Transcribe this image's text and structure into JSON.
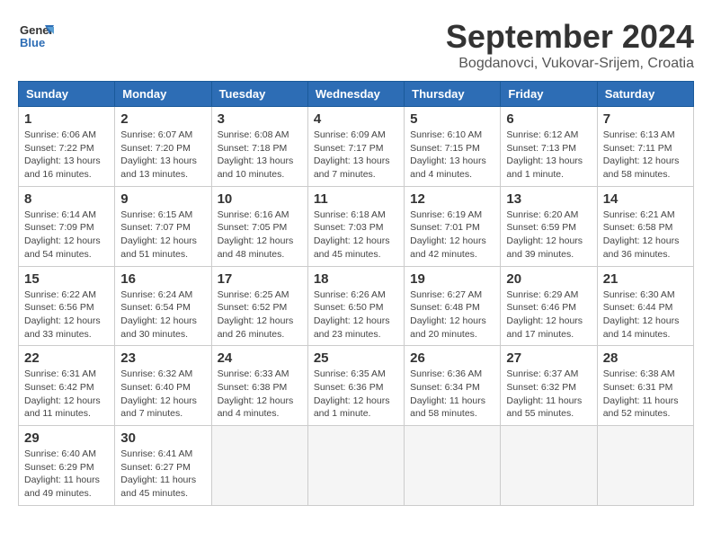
{
  "header": {
    "logo_line1": "General",
    "logo_line2": "Blue",
    "month_year": "September 2024",
    "location": "Bogdanovci, Vukovar-Srijem, Croatia"
  },
  "weekdays": [
    "Sunday",
    "Monday",
    "Tuesday",
    "Wednesday",
    "Thursday",
    "Friday",
    "Saturday"
  ],
  "weeks": [
    [
      {
        "day": "1",
        "info": "Sunrise: 6:06 AM\nSunset: 7:22 PM\nDaylight: 13 hours\nand 16 minutes."
      },
      {
        "day": "2",
        "info": "Sunrise: 6:07 AM\nSunset: 7:20 PM\nDaylight: 13 hours\nand 13 minutes."
      },
      {
        "day": "3",
        "info": "Sunrise: 6:08 AM\nSunset: 7:18 PM\nDaylight: 13 hours\nand 10 minutes."
      },
      {
        "day": "4",
        "info": "Sunrise: 6:09 AM\nSunset: 7:17 PM\nDaylight: 13 hours\nand 7 minutes."
      },
      {
        "day": "5",
        "info": "Sunrise: 6:10 AM\nSunset: 7:15 PM\nDaylight: 13 hours\nand 4 minutes."
      },
      {
        "day": "6",
        "info": "Sunrise: 6:12 AM\nSunset: 7:13 PM\nDaylight: 13 hours\nand 1 minute."
      },
      {
        "day": "7",
        "info": "Sunrise: 6:13 AM\nSunset: 7:11 PM\nDaylight: 12 hours\nand 58 minutes."
      }
    ],
    [
      {
        "day": "8",
        "info": "Sunrise: 6:14 AM\nSunset: 7:09 PM\nDaylight: 12 hours\nand 54 minutes."
      },
      {
        "day": "9",
        "info": "Sunrise: 6:15 AM\nSunset: 7:07 PM\nDaylight: 12 hours\nand 51 minutes."
      },
      {
        "day": "10",
        "info": "Sunrise: 6:16 AM\nSunset: 7:05 PM\nDaylight: 12 hours\nand 48 minutes."
      },
      {
        "day": "11",
        "info": "Sunrise: 6:18 AM\nSunset: 7:03 PM\nDaylight: 12 hours\nand 45 minutes."
      },
      {
        "day": "12",
        "info": "Sunrise: 6:19 AM\nSunset: 7:01 PM\nDaylight: 12 hours\nand 42 minutes."
      },
      {
        "day": "13",
        "info": "Sunrise: 6:20 AM\nSunset: 6:59 PM\nDaylight: 12 hours\nand 39 minutes."
      },
      {
        "day": "14",
        "info": "Sunrise: 6:21 AM\nSunset: 6:58 PM\nDaylight: 12 hours\nand 36 minutes."
      }
    ],
    [
      {
        "day": "15",
        "info": "Sunrise: 6:22 AM\nSunset: 6:56 PM\nDaylight: 12 hours\nand 33 minutes."
      },
      {
        "day": "16",
        "info": "Sunrise: 6:24 AM\nSunset: 6:54 PM\nDaylight: 12 hours\nand 30 minutes."
      },
      {
        "day": "17",
        "info": "Sunrise: 6:25 AM\nSunset: 6:52 PM\nDaylight: 12 hours\nand 26 minutes."
      },
      {
        "day": "18",
        "info": "Sunrise: 6:26 AM\nSunset: 6:50 PM\nDaylight: 12 hours\nand 23 minutes."
      },
      {
        "day": "19",
        "info": "Sunrise: 6:27 AM\nSunset: 6:48 PM\nDaylight: 12 hours\nand 20 minutes."
      },
      {
        "day": "20",
        "info": "Sunrise: 6:29 AM\nSunset: 6:46 PM\nDaylight: 12 hours\nand 17 minutes."
      },
      {
        "day": "21",
        "info": "Sunrise: 6:30 AM\nSunset: 6:44 PM\nDaylight: 12 hours\nand 14 minutes."
      }
    ],
    [
      {
        "day": "22",
        "info": "Sunrise: 6:31 AM\nSunset: 6:42 PM\nDaylight: 12 hours\nand 11 minutes."
      },
      {
        "day": "23",
        "info": "Sunrise: 6:32 AM\nSunset: 6:40 PM\nDaylight: 12 hours\nand 7 minutes."
      },
      {
        "day": "24",
        "info": "Sunrise: 6:33 AM\nSunset: 6:38 PM\nDaylight: 12 hours\nand 4 minutes."
      },
      {
        "day": "25",
        "info": "Sunrise: 6:35 AM\nSunset: 6:36 PM\nDaylight: 12 hours\nand 1 minute."
      },
      {
        "day": "26",
        "info": "Sunrise: 6:36 AM\nSunset: 6:34 PM\nDaylight: 11 hours\nand 58 minutes."
      },
      {
        "day": "27",
        "info": "Sunrise: 6:37 AM\nSunset: 6:32 PM\nDaylight: 11 hours\nand 55 minutes."
      },
      {
        "day": "28",
        "info": "Sunrise: 6:38 AM\nSunset: 6:31 PM\nDaylight: 11 hours\nand 52 minutes."
      }
    ],
    [
      {
        "day": "29",
        "info": "Sunrise: 6:40 AM\nSunset: 6:29 PM\nDaylight: 11 hours\nand 49 minutes."
      },
      {
        "day": "30",
        "info": "Sunrise: 6:41 AM\nSunset: 6:27 PM\nDaylight: 11 hours\nand 45 minutes."
      },
      {
        "day": "",
        "info": ""
      },
      {
        "day": "",
        "info": ""
      },
      {
        "day": "",
        "info": ""
      },
      {
        "day": "",
        "info": ""
      },
      {
        "day": "",
        "info": ""
      }
    ]
  ]
}
